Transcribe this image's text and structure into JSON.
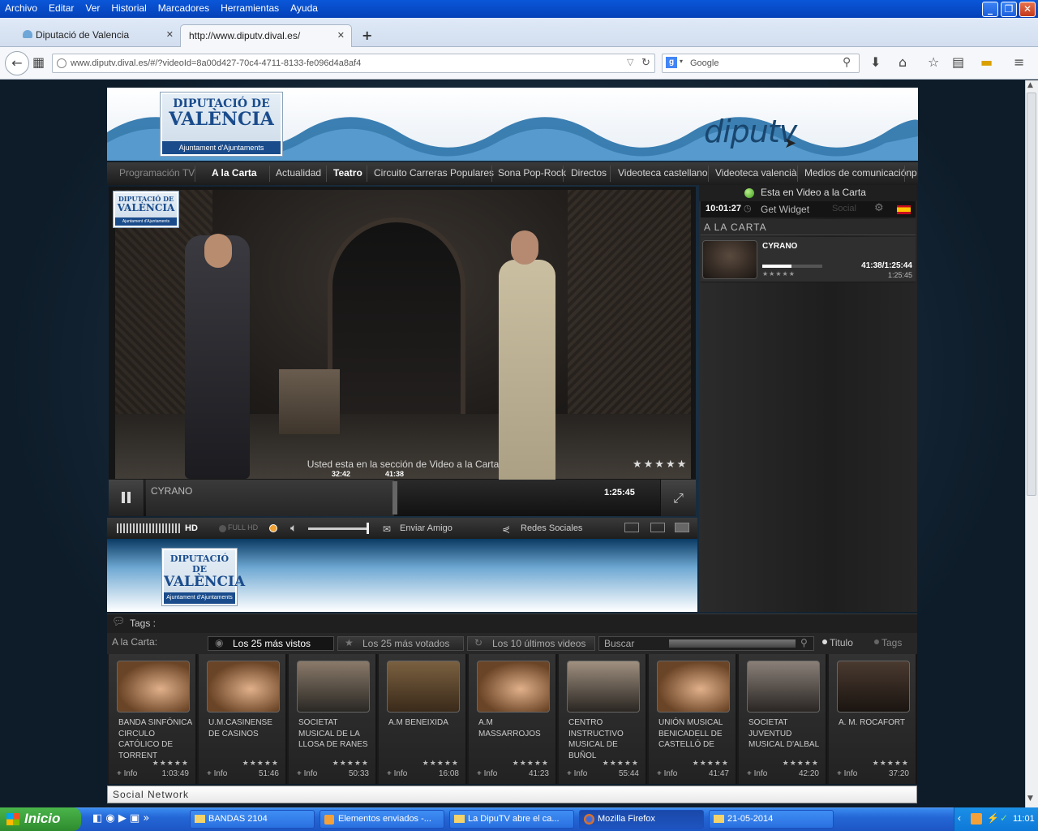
{
  "browser": {
    "menu": [
      "Archivo",
      "Editar",
      "Ver",
      "Historial",
      "Marcadores",
      "Herramientas",
      "Ayuda"
    ],
    "tabs": [
      {
        "label": "Diputació de Valencia",
        "close": "✕"
      },
      {
        "label": "http://www.diputv.dival.es/",
        "close": "✕"
      }
    ],
    "new_tab": "+",
    "url": "www.diputv.dival.es/#/?videoId=8a00d427-70c4-4711-8133-fe096d4a8af4",
    "search_placeholder": "Google"
  },
  "site": {
    "logo_line1": "DIPUTACIÓ DE",
    "logo_line2": "VALÈNCIA",
    "logo_band": "Ajuntament d'Ajuntaments",
    "brand": "diputv",
    "nav": [
      "Programación TV",
      "A la Carta",
      "Actualidad",
      "Teatro",
      "Circuito Carreras Populares",
      "Sona Pop-Rock",
      "Directos",
      "Videoteca castellano",
      "Videoteca valencià",
      "Medios de comunicación",
      "p"
    ],
    "player": {
      "overlay": "Usted esta en la sección de Video a la Carta",
      "title": "CYRANO",
      "duration": "1:25:45",
      "mark1": "32:42",
      "mark2": "41:38",
      "stars": "★★★★★",
      "progress": 0.486
    },
    "toolbar": {
      "hd": "HD",
      "fullhd": "FULL HD",
      "send": "Enviar Amigo",
      "social": "Redes Sociales"
    },
    "panel": {
      "status": "Esta en Video a la Carta",
      "clock": "10:01:27",
      "widget": "Get Widget",
      "social": "Social",
      "heading": "A LA CARTA",
      "item_title": "CYRANO",
      "item_time": "41:38/1:25:44",
      "item_total": "1:25:45",
      "item_progress": 0.486
    },
    "tags_label": "Tags :",
    "filter": {
      "label": "A la Carta:",
      "btn1": "Los 25 más vistos",
      "btn2": "Los 25 más votados",
      "btn3": "Los 10 últimos videos",
      "search": "Buscar",
      "opt1": "Titulo",
      "opt2": "Tags"
    },
    "videos": [
      {
        "title": "BANDA SINFÓNICA CIRCULO CATÓLICO DE TORRENT",
        "dur": "1:03:49",
        "info": "+ Info"
      },
      {
        "title": "U.M.CASINENSE DE CASINOS",
        "dur": "51:46",
        "info": "+ Info"
      },
      {
        "title": "SOCIETAT MUSICAL DE LA LLOSA DE RANES",
        "dur": "50:33",
        "info": "+ Info"
      },
      {
        "title": "A.M BENEIXIDA",
        "dur": "16:08",
        "info": "+ Info"
      },
      {
        "title": "A.M MASSARROJOS",
        "dur": "41:23",
        "info": "+ Info"
      },
      {
        "title": "CENTRO INSTRUCTIVO MUSICAL DE BUÑOL",
        "dur": "55:44",
        "info": "+ Info"
      },
      {
        "title": "UNIÓN MUSICAL BENICADELL DE CASTELLÓ DE",
        "dur": "41:47",
        "info": "+ Info"
      },
      {
        "title": "SOCIETAT JUVENTUD MUSICAL D'ALBAL",
        "dur": "42:20",
        "info": "+ Info"
      },
      {
        "title": "A. M. ROCAFORT",
        "dur": "37:20",
        "info": "+ Info"
      }
    ],
    "social_network": "Social Network"
  },
  "taskbar": {
    "start": "Inicio",
    "items": [
      "BANDAS 2104",
      "Elementos enviados -...",
      "La DipuTV abre el ca...",
      "Mozilla Firefox",
      "21-05-2014"
    ],
    "clock": "11:01"
  }
}
